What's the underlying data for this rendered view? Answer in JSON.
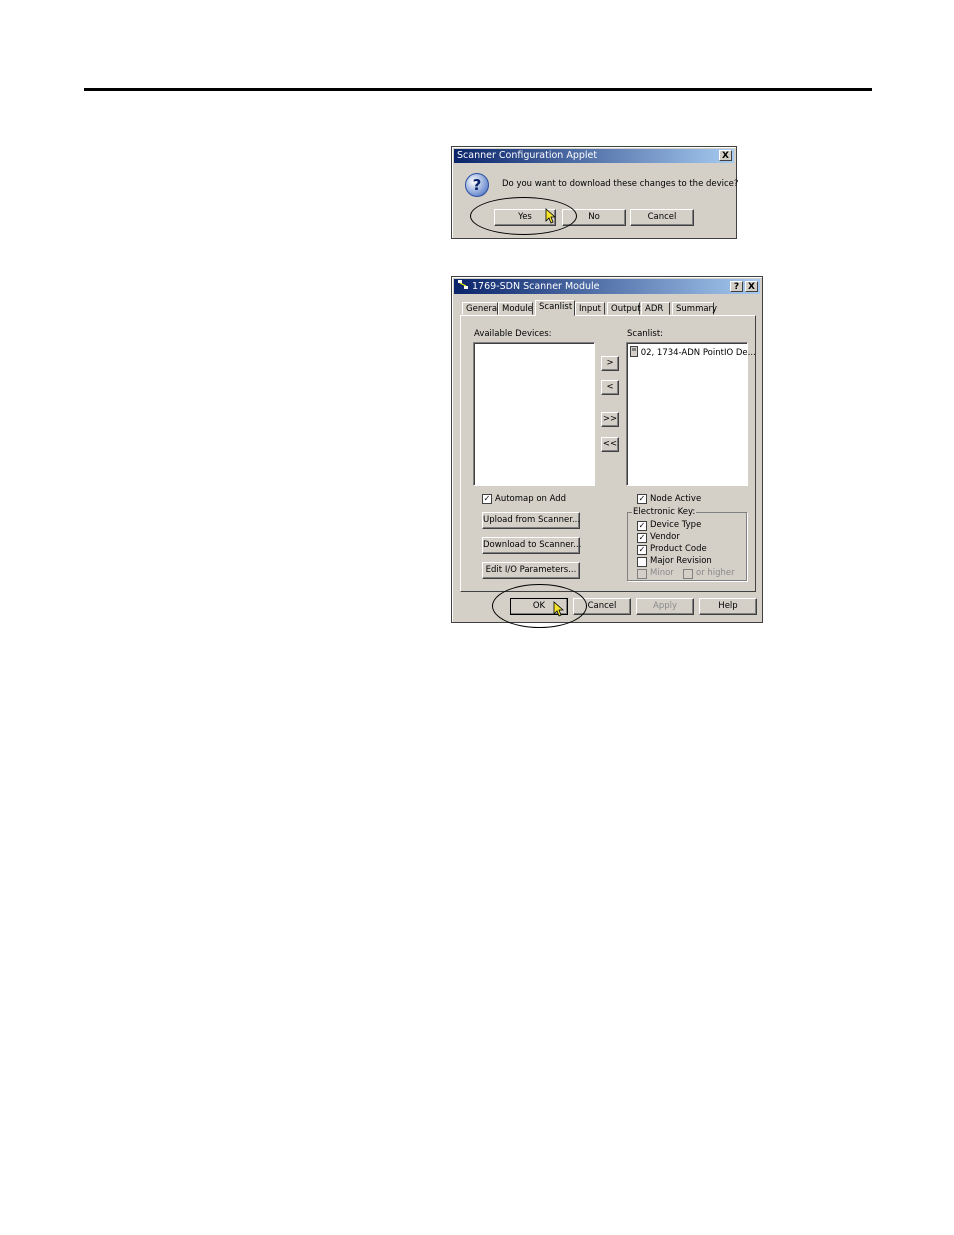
{
  "dialog1": {
    "title": "Scanner Configuration Applet",
    "message": "Do you want to download these changes to the device?",
    "buttons": {
      "yes": "Yes",
      "no": "No",
      "cancel": "Cancel"
    },
    "close_glyph": "X"
  },
  "dialog2": {
    "title": "1769-SDN Scanner Module",
    "help_glyph": "?",
    "close_glyph": "X",
    "tabs": [
      "General",
      "Module",
      "Scanlist",
      "Input",
      "Output",
      "ADR",
      "Summary"
    ],
    "active_tab": "Scanlist",
    "available_devices_label": "Available Devices:",
    "scanlist_label": "Scanlist:",
    "scanlist_items": [
      "02, 1734-ADN PointIO De..."
    ],
    "move_buttons": [
      ">",
      "<",
      ">>",
      "<<"
    ],
    "automap_label": "Automap on Add",
    "automap_checked": true,
    "upload_button": "Upload from Scanner...",
    "download_button": "Download to Scanner...",
    "edit_io_button": "Edit I/O Parameters...",
    "node_active_label": "Node Active",
    "node_active_checked": true,
    "electronic_key_label": "Electronic Key:",
    "key_options": [
      {
        "label": "Device Type",
        "checked": true
      },
      {
        "label": "Vendor",
        "checked": true
      },
      {
        "label": "Product Code",
        "checked": true
      },
      {
        "label": "Major Revision",
        "checked": false
      }
    ],
    "minor_label": "Minor",
    "or_higher_label": "or higher",
    "footer_buttons": {
      "ok": "OK",
      "cancel": "Cancel",
      "apply": "Apply",
      "help": "Help"
    }
  },
  "colors": {
    "titlebar_start": "#0a246a",
    "titlebar_end": "#a6caf0",
    "face": "#d4d0c8",
    "cursor": "#f7e52b"
  },
  "icons": {
    "question": "question-icon",
    "cursor": "mouse-pointer-icon",
    "app": "network-icon"
  }
}
